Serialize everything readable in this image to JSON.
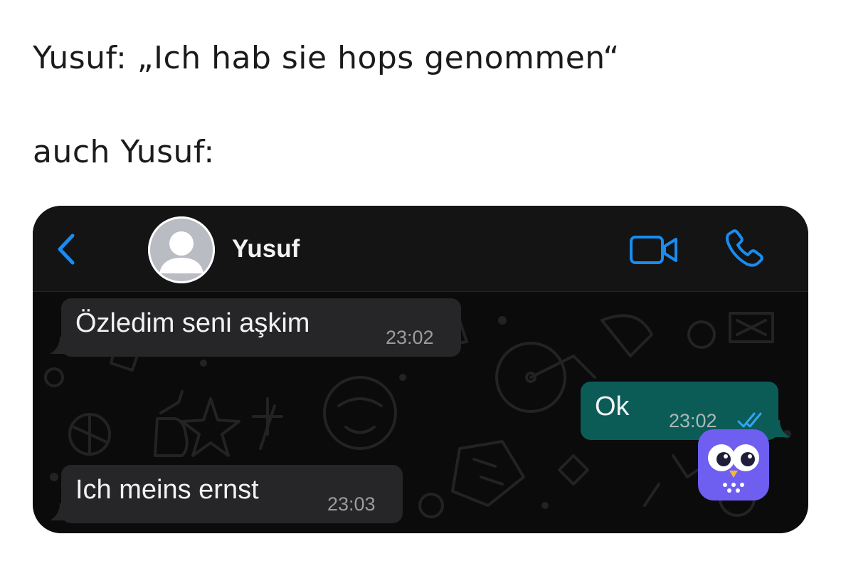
{
  "caption": {
    "line1": "Yusuf: „Ich hab sie hops genommen“",
    "line2": "auch Yusuf:"
  },
  "chat": {
    "contact_name": "Yusuf",
    "back_icon": "chevron-left-icon",
    "video_icon": "video-camera-icon",
    "call_icon": "phone-icon",
    "accent_color": "#1a8cf0",
    "messages": [
      {
        "direction": "incoming",
        "text": "Özledim seni aşkim",
        "time": "23:02"
      },
      {
        "direction": "outgoing",
        "text": "Ok",
        "time": "23:02",
        "status": "read"
      },
      {
        "direction": "incoming",
        "text": "Ich meins ernst",
        "time": "23:03"
      }
    ]
  },
  "colors": {
    "background": "#ffffff",
    "chat_background": "#0b0b0b",
    "incoming_bubble": "#262628",
    "outgoing_bubble": "#0b5c57",
    "owl_logo": "#6e5ff0"
  }
}
